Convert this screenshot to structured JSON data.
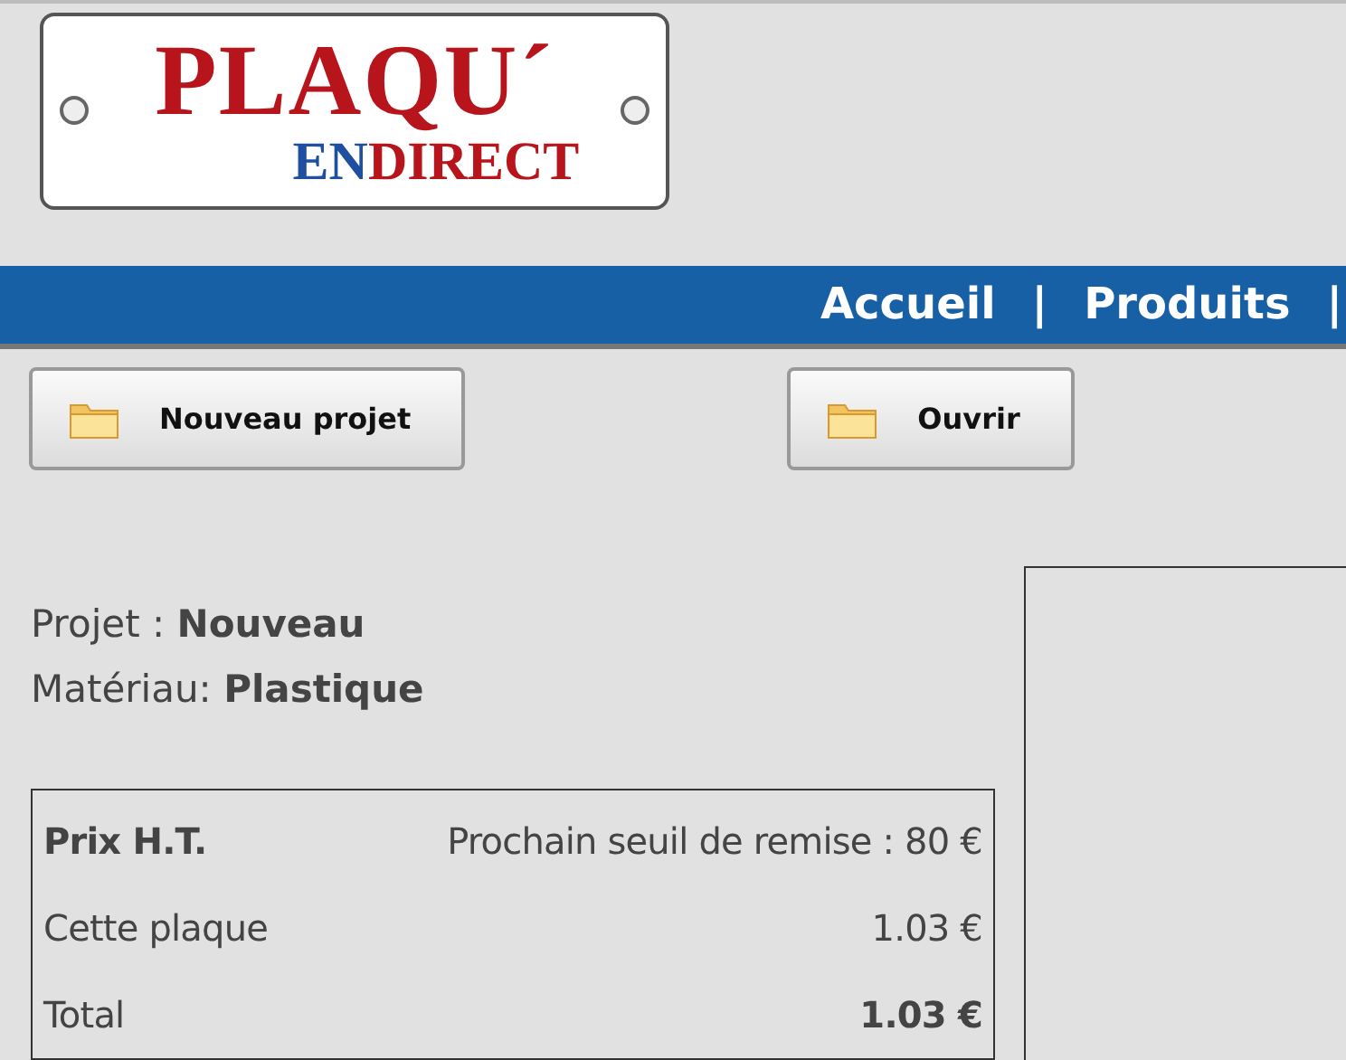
{
  "logo": {
    "top": "PLAQU´",
    "bottom_blue": "EN",
    "bottom_red": "DIRECT"
  },
  "nav": {
    "items": [
      "Accueil",
      "Produits"
    ],
    "separator": "|"
  },
  "buttons": [
    {
      "label": "Nouveau projet"
    },
    {
      "label": "Ouvrir"
    }
  ],
  "info": [
    {
      "label": "Projet :",
      "value": "Nouveau"
    },
    {
      "label": "Matériau:",
      "value": "Plastique"
    }
  ],
  "price": {
    "title": "Prix H.T.",
    "threshold": "Prochain seuil de remise : 80 €",
    "rows": [
      {
        "label": "Cette plaque",
        "value": "1.03 €",
        "bold": false
      },
      {
        "label": "Total",
        "value": "1.03 €",
        "bold": true
      }
    ]
  }
}
